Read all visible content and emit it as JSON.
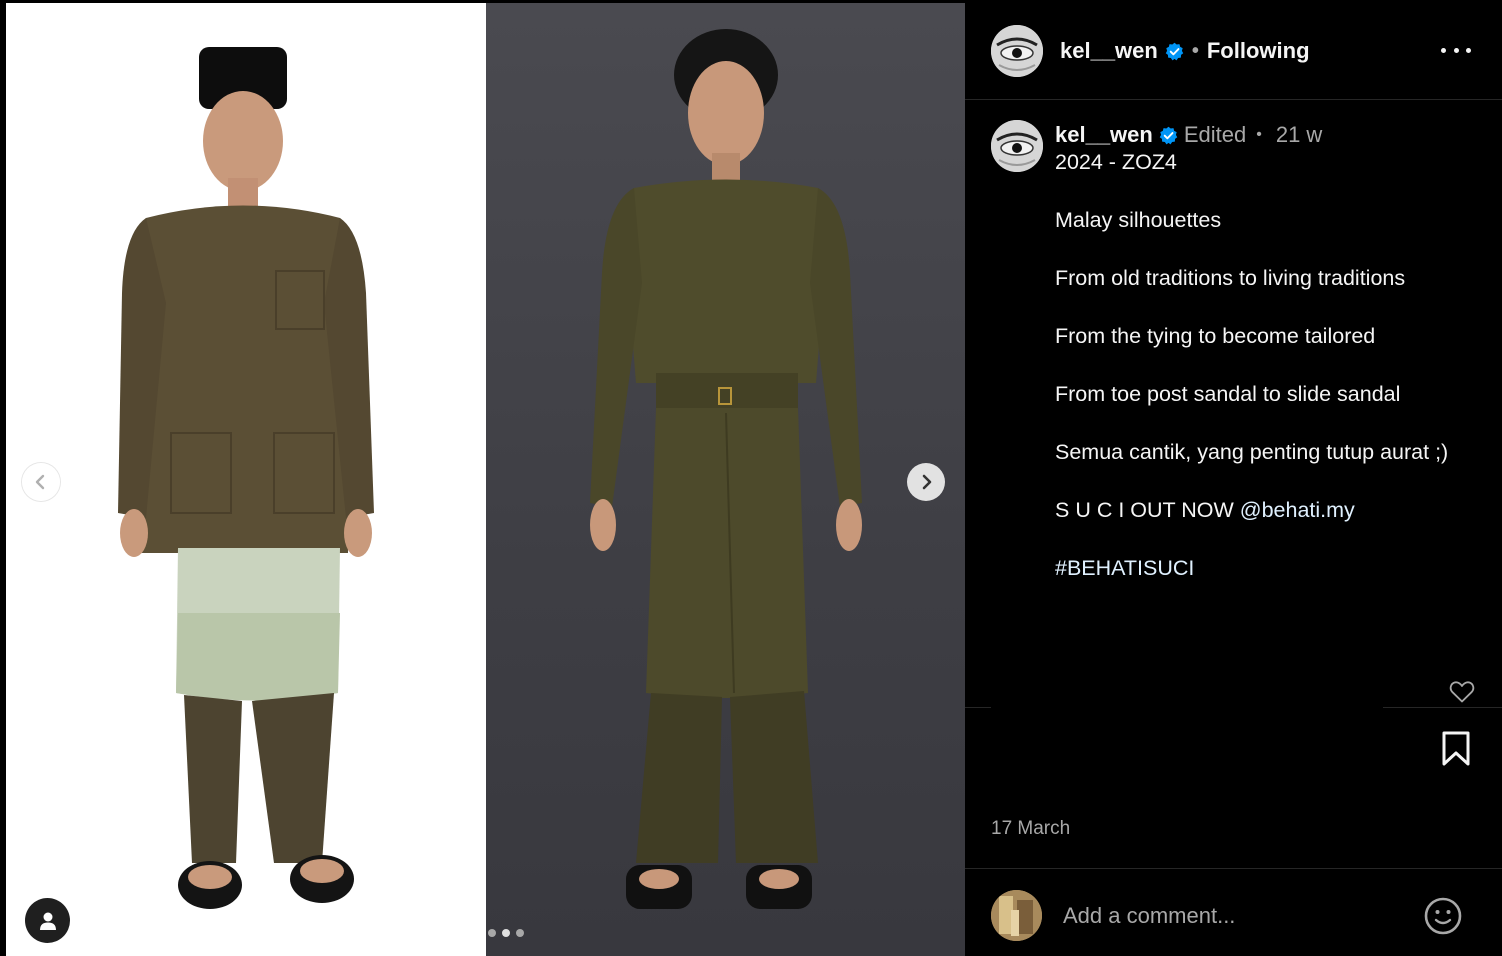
{
  "post": {
    "username": "kel__wen",
    "follow_status": "Following",
    "separator": "•",
    "edited_label": "Edited",
    "time_ago": "21 w",
    "date": "17 March",
    "caption_lines": [
      "2024 - ZOZ4",
      "",
      "Malay silhouettes",
      "",
      "From old traditions to living traditions",
      "",
      "From the tying to become tailored",
      "",
      "From toe post sandal to slide sandal",
      "",
      "Semua cantik, yang penting tutup aurat ;)",
      ""
    ],
    "caption_mention_prefix": "S U C I OUT NOW ",
    "caption_mention": "@behati.my",
    "caption_hashtag": "#BEHATISUCI"
  },
  "comment": {
    "placeholder": "Add a comment..."
  },
  "carousel": {
    "slides": 3,
    "active_slide": 2
  },
  "icons": {
    "verified": "verified-badge-icon",
    "more": "more-options-icon",
    "like": "heart-icon",
    "save": "bookmark-icon",
    "emoji": "emoji-icon",
    "prev": "chevron-left-icon",
    "next": "chevron-right-icon",
    "tags": "user-tag-icon"
  },
  "colors": {
    "background": "#000000",
    "text": "#f5f5f5",
    "secondary_text": "#a8a8a8",
    "verified_blue": "#0095f6",
    "divider": "#262626"
  }
}
